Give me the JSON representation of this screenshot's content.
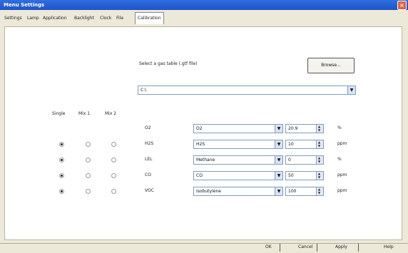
{
  "window": {
    "title": "Menu Settings",
    "close_glyph": "×"
  },
  "tabs": [
    {
      "label": "Settings"
    },
    {
      "label": "Lamp"
    },
    {
      "label": "Application"
    },
    {
      "label": "Backlight"
    },
    {
      "label": "Clock"
    },
    {
      "label": "File"
    },
    {
      "label": "Calibration"
    }
  ],
  "gas_table": {
    "prompt": "Select a gas table (.gtf file)",
    "browse_label": "Browse...",
    "path_value": "C:\\"
  },
  "columns": {
    "single": "Single",
    "mix1": "Mix 1",
    "mix2": "Mix 2"
  },
  "rows": [
    {
      "name": "O2",
      "gas": "O2",
      "value": "20.9",
      "unit": "%",
      "show_radios": false,
      "single": true,
      "mix1": false,
      "mix2": false
    },
    {
      "name": "H2S",
      "gas": "H2S",
      "value": "10",
      "unit": "ppm",
      "show_radios": true,
      "single": true,
      "mix1": false,
      "mix2": false
    },
    {
      "name": "LEL",
      "gas": "Methane",
      "value": "0",
      "unit": "%",
      "show_radios": true,
      "single": true,
      "mix1": false,
      "mix2": false
    },
    {
      "name": "CO",
      "gas": "CO",
      "value": "50",
      "unit": "ppm",
      "show_radios": true,
      "single": true,
      "mix1": false,
      "mix2": false
    },
    {
      "name": "VOC",
      "gas": "Isobutylene",
      "value": "100",
      "unit": "ppm",
      "show_radios": true,
      "single": true,
      "mix1": false,
      "mix2": false
    }
  ],
  "footer": {
    "ok": "OK",
    "cancel": "Cancel",
    "apply": "Apply",
    "help": "Help"
  },
  "icons": {
    "dropdown": "▼",
    "up": "▲",
    "down": "▼"
  },
  "colors": {
    "titlebar": "#1f54c9",
    "dialog_bg": "#ece9d8",
    "close": "#e0623d"
  }
}
